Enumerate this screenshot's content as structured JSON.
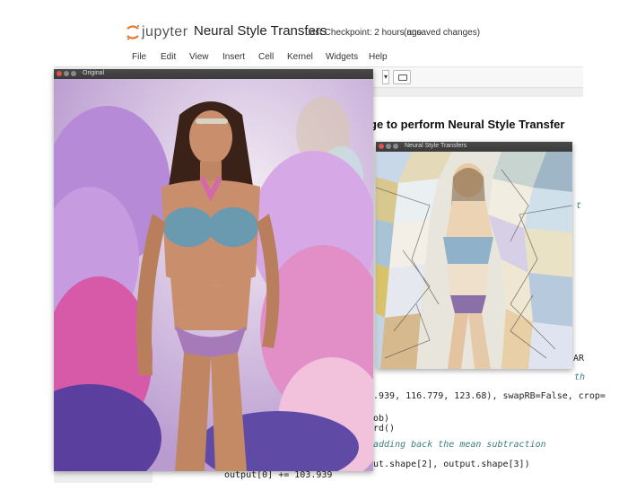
{
  "jupyter": {
    "logo_text": "jupyter",
    "notebook_title": "Neural Style Transfers",
    "checkpoint": "Last Checkpoint: 2 hours ago",
    "unsaved": "(unsaved changes)",
    "menu": [
      "File",
      "Edit",
      "View",
      "Insert",
      "Cell",
      "Kernel",
      "Widgets",
      "Help"
    ],
    "heading_partial": "ge to perform Neural Style Transfer",
    "code_lines": {
      "line1": ".939, 116.779, 123.68), swapRB=False, crop=",
      "line2": "ob)",
      "line3": "rd()",
      "comment": "adding back  the mean subtraction",
      "line5": "ut.shape[2], output.shape[3])",
      "line6": "output[0] += 103.939",
      "right_edge_1": "AR",
      "right_edge_2": "th",
      "right_edge_3": "t"
    }
  },
  "windows": {
    "original": {
      "title": "Original"
    },
    "styled": {
      "title": "Neural Style Transfers"
    }
  },
  "colors": {
    "jupyter_orange": "#f37726",
    "titlebar": "#3c3c3c",
    "close_button": "#d9534f"
  }
}
